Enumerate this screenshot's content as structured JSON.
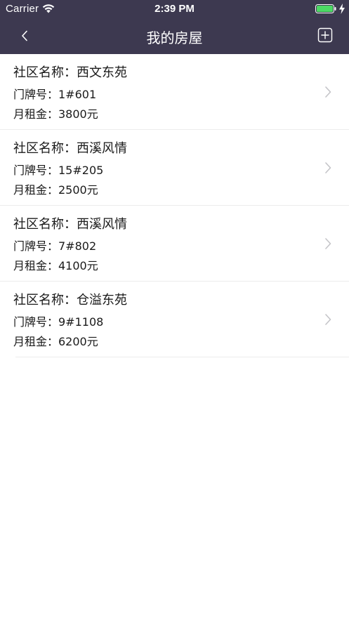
{
  "status_bar": {
    "carrier": "Carrier",
    "time": "2:39 PM"
  },
  "nav": {
    "title": "我的房屋",
    "back_icon": "chevron-left-icon",
    "add_icon": "plus-square-icon"
  },
  "houses": [
    {
      "community": "社区名称：西文东苑",
      "door": "门牌号：1#601",
      "rent": "月租金：3800元"
    },
    {
      "community": "社区名称：西溪风情",
      "door": "门牌号：15#205",
      "rent": "月租金：2500元"
    },
    {
      "community": "社区名称：西溪风情",
      "door": "门牌号：7#802",
      "rent": "月租金：4100元"
    },
    {
      "community": "社区名称：仓溢东苑",
      "door": "门牌号：9#1108",
      "rent": "月租金：6200元"
    }
  ],
  "colors": {
    "nav_bg": "#3d3950",
    "battery": "#4cd964"
  }
}
